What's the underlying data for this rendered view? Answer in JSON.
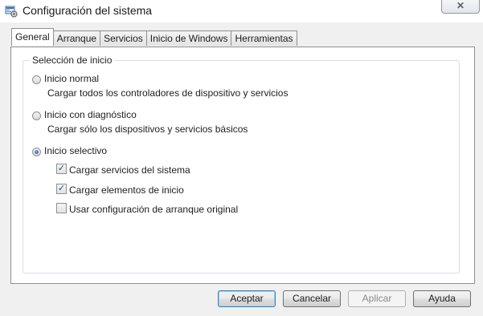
{
  "window": {
    "title": "Configuración del sistema",
    "close_glyph": "✕",
    "app_icon": "msconfig-icon"
  },
  "tabs": [
    {
      "label": "General",
      "active": true
    },
    {
      "label": "Arranque",
      "active": false
    },
    {
      "label": "Servicios",
      "active": false
    },
    {
      "label": "Inicio de Windows",
      "active": false
    },
    {
      "label": "Herramientas",
      "active": false
    }
  ],
  "startup_group": {
    "legend": "Selección de inicio",
    "options": [
      {
        "label": "Inicio normal",
        "description": "Cargar todos los controladores de dispositivo y servicios",
        "selected": false
      },
      {
        "label": "Inicio con diagnóstico",
        "description": "Cargar sólo los dispositivos y servicios básicos",
        "selected": false
      },
      {
        "label": "Inicio selectivo",
        "selected": true
      }
    ],
    "selective_checks": [
      {
        "label": "Cargar servicios del sistema",
        "checked": true
      },
      {
        "label": "Cargar elementos de inicio",
        "checked": true
      },
      {
        "label": "Usar configuración de arranque original",
        "checked": false
      }
    ],
    "check_glyph": "✓"
  },
  "buttons": {
    "accept": "Aceptar",
    "cancel": "Cancelar",
    "apply": "Aplicar",
    "help": "Ayuda"
  },
  "colors": {
    "window_bg": "#f0f0f0",
    "panel_bg": "#ffffff",
    "default_button_border": "#3c7fb1",
    "radio_selected": "#1c4f8f"
  }
}
